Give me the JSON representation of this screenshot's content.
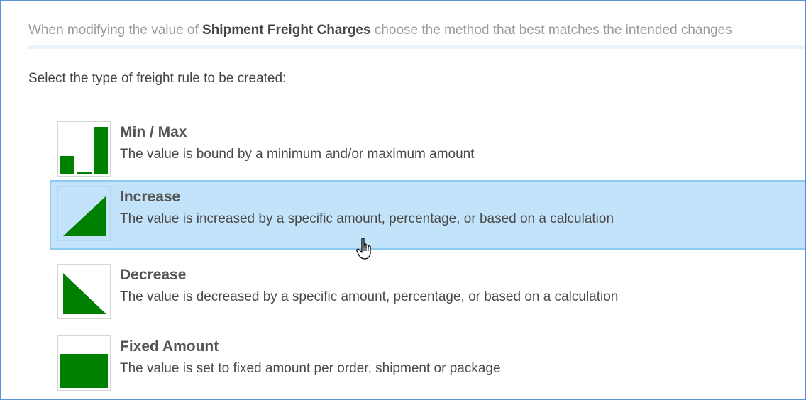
{
  "intro": {
    "prefix": "When modifying the value of",
    "field_name": "Shipment Freight Charges",
    "suffix": "choose the method that best matches the intended changes"
  },
  "prompt": "Select the type of freight rule to be created:",
  "options": [
    {
      "title": "Min / Max",
      "description": "The value is bound by a minimum and/or maximum amount",
      "icon": "min-max-icon",
      "selected": false
    },
    {
      "title": "Increase",
      "description": "The value is increased by a specific amount, percentage, or based on a calculation",
      "icon": "increase-icon",
      "selected": true
    },
    {
      "title": "Decrease",
      "description": "The value is decreased by a specific amount, percentage, or based on a calculation",
      "icon": "decrease-icon",
      "selected": false
    },
    {
      "title": "Fixed Amount",
      "description": "The value is set to fixed amount per order, shipment or package",
      "icon": "fixed-amount-icon",
      "selected": false
    }
  ],
  "colors": {
    "icon_fill": "#008000",
    "selected_background": "#c3e3fa",
    "selected_border": "#8ccaf0",
    "frame_border": "#5b8fd6"
  }
}
